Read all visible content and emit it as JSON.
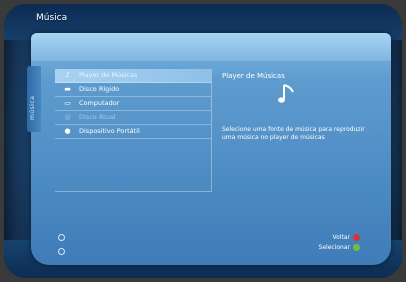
{
  "blade": {
    "title": "Música",
    "side_tab_label": "música"
  },
  "menu": {
    "items": [
      {
        "label": "Player de Músicas",
        "icon": "music-player-icon",
        "state": "selected"
      },
      {
        "label": "Disco Rígido",
        "icon": "hard-drive-icon",
        "state": "normal"
      },
      {
        "label": "Computador",
        "icon": "computer-icon",
        "state": "normal"
      },
      {
        "label": "Disco Atual",
        "icon": "disc-icon",
        "state": "disabled"
      },
      {
        "label": "Dispositivo Portátil",
        "icon": "portable-device-icon",
        "state": "normal"
      }
    ]
  },
  "detail": {
    "title": "Player de Músicas",
    "icon": "music-note-icon",
    "description": "Selecione uma fonte de música para reproduzir uma música no player de músicas"
  },
  "footer": {
    "back_label": "Voltar",
    "select_label": "Selecionar",
    "back_color": "#d8323a",
    "select_color": "#6fbf3a"
  }
}
